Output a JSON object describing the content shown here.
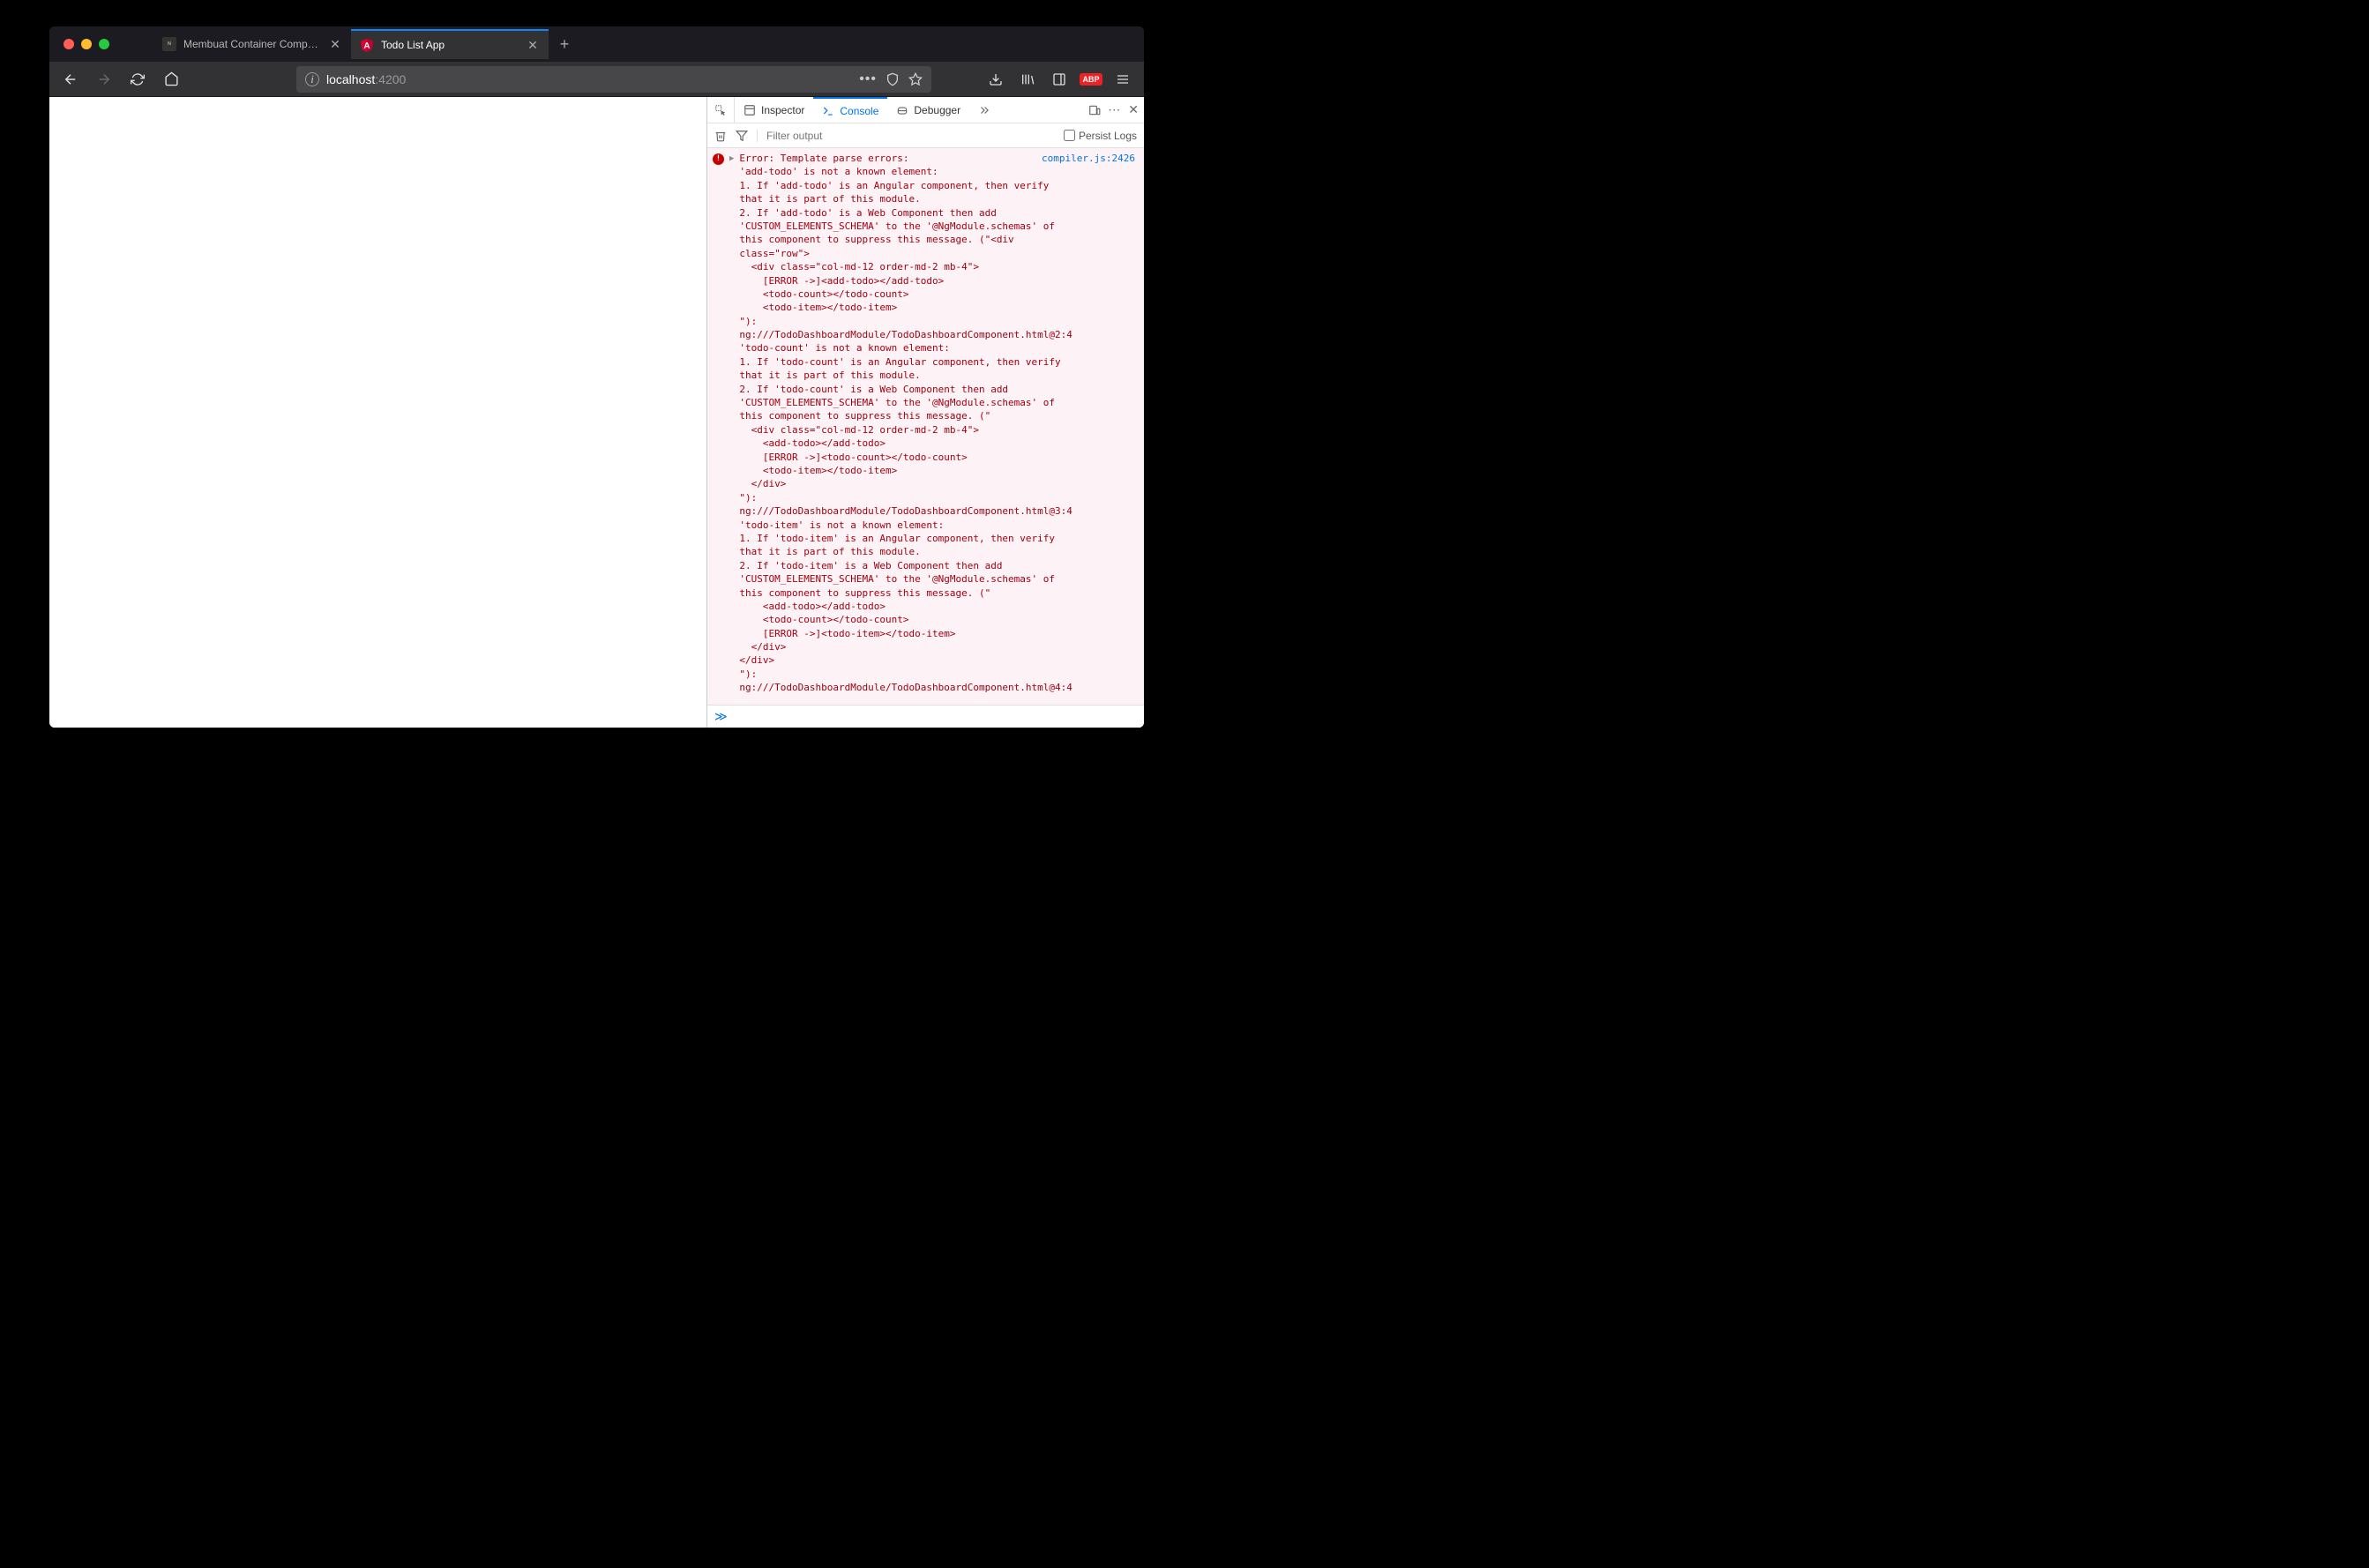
{
  "tabs": [
    {
      "title": "Membuat Container Component",
      "favicon": "nn"
    },
    {
      "title": "Todo List App",
      "favicon": "A"
    }
  ],
  "url": {
    "host": "localhost",
    "path": ":4200"
  },
  "devtools": {
    "tabs": {
      "inspector": "Inspector",
      "console": "Console",
      "debugger": "Debugger"
    },
    "filter_placeholder": "Filter output",
    "persist_label": "Persist Logs",
    "source_link": "compiler.js:2426",
    "error_message": "Error: Template parse errors:\n'add-todo' is not a known element:\n1. If 'add-todo' is an Angular component, then verify that it is part of this module.\n2. If 'add-todo' is a Web Component then add 'CUSTOM_ELEMENTS_SCHEMA' to the '@NgModule.schemas' of this component to suppress this message. (\"<div class=\"row\">\n  <div class=\"col-md-12 order-md-2 mb-4\">\n    [ERROR ->]<add-todo></add-todo>\n    <todo-count></todo-count>\n    <todo-item></todo-item>\n\"): ng:///TodoDashboardModule/TodoDashboardComponent.html@2:4\n'todo-count' is not a known element:\n1. If 'todo-count' is an Angular component, then verify that it is part of this module.\n2. If 'todo-count' is a Web Component then add 'CUSTOM_ELEMENTS_SCHEMA' to the '@NgModule.schemas' of this component to suppress this message. (\"\n  <div class=\"col-md-12 order-md-2 mb-4\">\n    <add-todo></add-todo>\n    [ERROR ->]<todo-count></todo-count>\n    <todo-item></todo-item>\n  </div>\n\"): ng:///TodoDashboardModule/TodoDashboardComponent.html@3:4\n'todo-item' is not a known element:\n1. If 'todo-item' is an Angular component, then verify that it is part of this module.\n2. If 'todo-item' is a Web Component then add 'CUSTOM_ELEMENTS_SCHEMA' to the '@NgModule.schemas' of this component to suppress this message. (\"\n    <add-todo></add-todo>\n    <todo-count></todo-count>\n    [ERROR ->]<todo-item></todo-item>\n  </div>\n</div>\n\"): ng:///TodoDashboardModule/TodoDashboardComponent.html@4:4"
  }
}
